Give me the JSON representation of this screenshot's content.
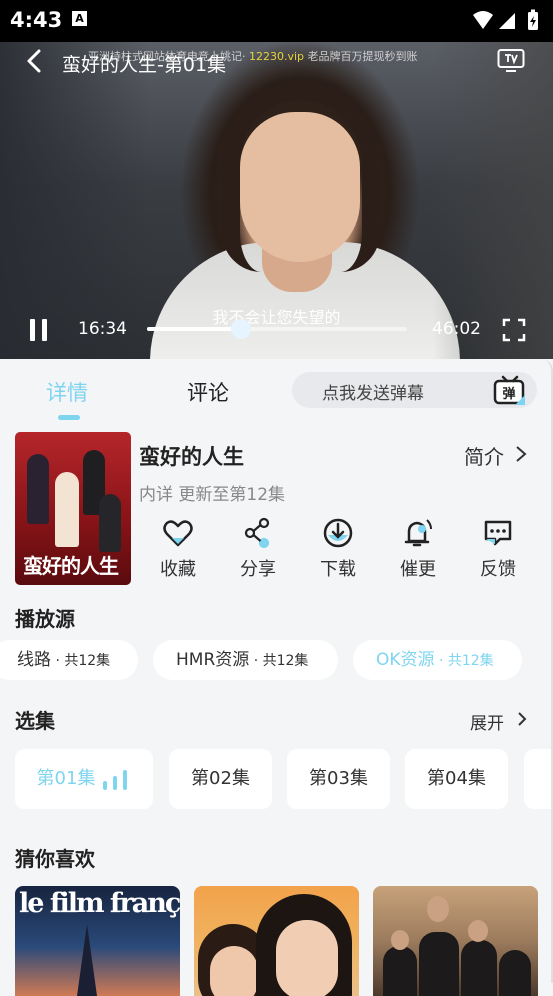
{
  "status_bar": {
    "time": "4:43",
    "notification_icon": "A"
  },
  "player": {
    "title": "蛮好的人生-第01集",
    "marquee_prefix": "亚洲持柱式网站体育电竞上姚记·",
    "marquee_highlight": "12230.vip",
    "marquee_suffix": "老品牌百万提现秒到账",
    "subtitle": "我不会让您失望的",
    "current_time": "16:34",
    "total_time": "46:02",
    "progress": 0.36
  },
  "tabs": {
    "details": "详情",
    "comments": "评论"
  },
  "danmu": {
    "placeholder": "点我发送弹幕",
    "icon_label": "弹"
  },
  "show": {
    "poster_title": "蛮好的人生",
    "title": "蛮好的人生",
    "intro_label": "简介",
    "update_info": "内详 更新至第12集"
  },
  "actions": [
    {
      "label": "收藏",
      "icon": "heart-icon"
    },
    {
      "label": "分享",
      "icon": "share-icon"
    },
    {
      "label": "下载",
      "icon": "download-icon"
    },
    {
      "label": "催更",
      "icon": "bell-icon"
    },
    {
      "label": "反馈",
      "icon": "feedback-icon"
    }
  ],
  "sources": {
    "heading": "播放源",
    "items": [
      {
        "name": "线路",
        "count": " · 共12集"
      },
      {
        "name": "HMR资源",
        "count": " · 共12集"
      },
      {
        "name": "OK资源",
        "count": " · 共12集",
        "active": true
      }
    ]
  },
  "episodes": {
    "heading": "选集",
    "expand_label": "展开",
    "items": [
      "第01集",
      "第02集",
      "第03集",
      "第04集"
    ]
  },
  "recommend": {
    "heading": "猜你喜欢",
    "item1_text": "le film français"
  },
  "colors": {
    "accent": "#7fd4ef",
    "background": "#f4f5f7"
  }
}
